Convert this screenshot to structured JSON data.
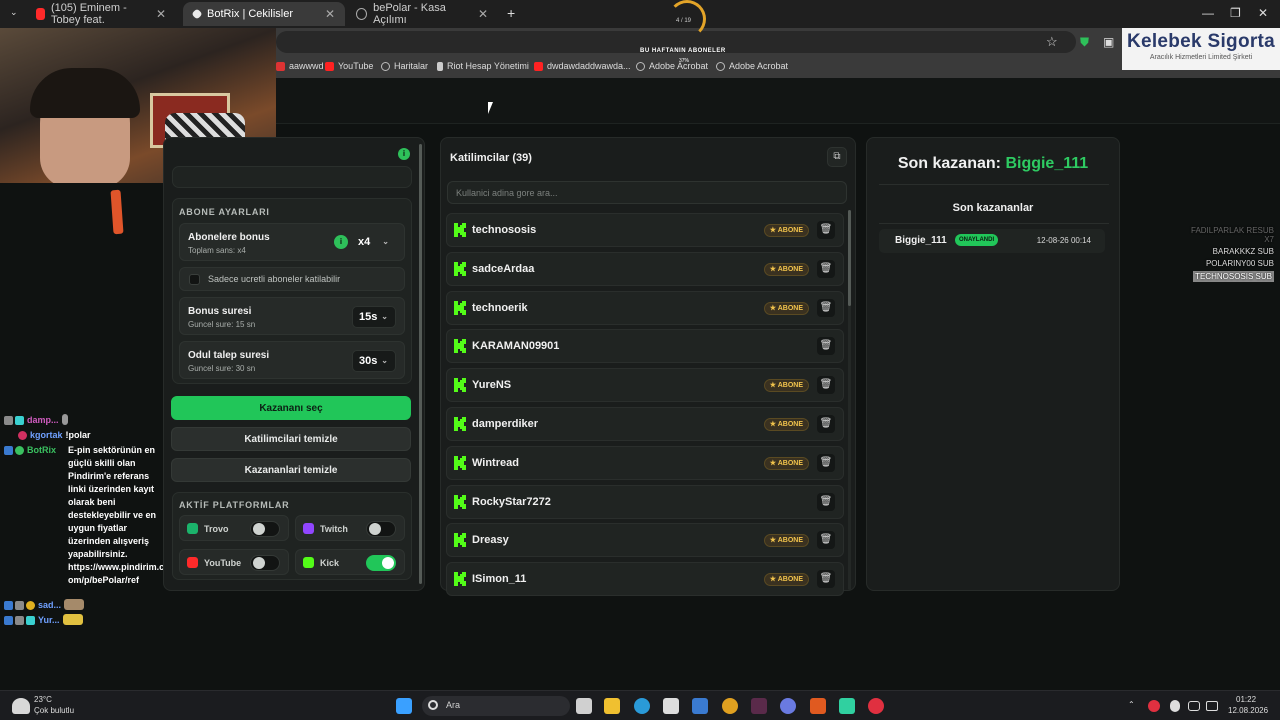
{
  "browser": {
    "tabs": [
      {
        "label": "(105) Eminem - Tobey feat.",
        "close": "✕"
      },
      {
        "label": "BotRix | Cekilisler",
        "close": "✕"
      },
      {
        "label": "bePolar - Kasa Açılımı",
        "close": "✕"
      }
    ],
    "new_tab": "+",
    "bookmarks": [
      "aawwwd",
      "YouTube",
      "Haritalar",
      "Riot Hesap Yönetimi",
      "dwdawdaddwawda...",
      "Adobe Acrobat",
      "Adobe Acrobat"
    ]
  },
  "overlay": {
    "progress_label": "4 / 19",
    "subs_title": "BU HAFTANIN ABONELER",
    "subs_pct": "37%",
    "sponsor_title": "Kelebek Sigorta",
    "sponsor_subtitle": "Aracılık Hizmetleri Limited Şirketi",
    "recent_subs": [
      "FADILPARLAK RESUB X7",
      "BARAKKKZ SUB",
      "POLARINY00 SUB",
      "TECHNOSOSIS SUB"
    ]
  },
  "chat": {
    "messages": [
      {
        "user": "damp...",
        "text": "",
        "color": "#d05cc0"
      },
      {
        "user": "kgortak",
        "text": "!polar",
        "color": "#6fa0ff"
      },
      {
        "user": "BotRix",
        "text": "E-pin sektörünün en güçlü skilli olan Pindirim'e referans linki üzerinden kayıt olarak beni destekleyebilir ve en uygun fiyatlar üzerinden alışveriş yapabilirsiniz. https://www.pindirim.com/p/bePolar/ref",
        "color": "#3ac060"
      },
      {
        "user": "sad...",
        "text": "",
        "color": "#6fa0ff"
      },
      {
        "user": "Yur...",
        "text": "",
        "color": "#6fa0ff"
      }
    ]
  },
  "settings": {
    "section_title": "ABONE AYARLARI",
    "bonus_title": "Abonelere bonus",
    "bonus_sub": "Toplam sans: x4",
    "bonus_value": "x4",
    "only_paid": "Sadece ucretli aboneler katilabilir",
    "bonus_duration_title": "Bonus suresi",
    "bonus_duration_sub": "Guncel sure: 15 sn",
    "bonus_duration_value": "15s",
    "claim_title": "Odul talep suresi",
    "claim_sub": "Guncel sure: 30 sn",
    "claim_value": "30s",
    "pick_winner": "Kazananı seç",
    "clear_participants": "Katilimcilari temizle",
    "clear_winners": "Kazananlari temizle",
    "platforms_title": "AKTİF PLATFORMLAR",
    "platforms": [
      {
        "label": "Trovo",
        "on": false,
        "color": "#1bb36b"
      },
      {
        "label": "Twitch",
        "on": false,
        "color": "#9146ff"
      },
      {
        "label": "YouTube",
        "on": false,
        "color": "#ff2a2a"
      },
      {
        "label": "Kick",
        "on": true,
        "color": "#53fc18"
      }
    ]
  },
  "participants": {
    "title": "Katilimcilar (39)",
    "search_placeholder": "Kullanici adina gore ara...",
    "badge_label": "★ ABONE",
    "items": [
      {
        "name": "technososis",
        "sub": true
      },
      {
        "name": "sadceArdaa",
        "sub": true
      },
      {
        "name": "technoerik",
        "sub": true
      },
      {
        "name": "KARAMAN09901",
        "sub": false
      },
      {
        "name": "YureNS",
        "sub": true
      },
      {
        "name": "damperdiker",
        "sub": true
      },
      {
        "name": "Wintread",
        "sub": true
      },
      {
        "name": "RockyStar7272",
        "sub": false
      },
      {
        "name": "Dreasy",
        "sub": true
      },
      {
        "name": "ISimon_11",
        "sub": true
      }
    ]
  },
  "winners": {
    "last_label": "Son kazanan:",
    "last_name": "Biggie_111",
    "recent_title": "Son kazananlar",
    "rows": [
      {
        "name": "Biggie_111",
        "status": "ONAYLANDI",
        "date": "12-08-26 00:14"
      }
    ]
  },
  "taskbar": {
    "weather_temp": "23°C",
    "weather_desc": "Çok bulutlu",
    "search": "Ara",
    "time": "01:22",
    "date": "12.08.2026"
  }
}
